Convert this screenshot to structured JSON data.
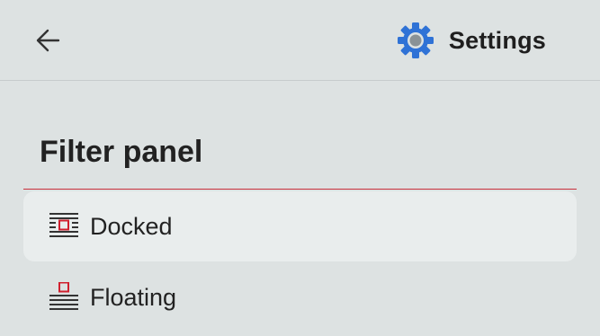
{
  "header": {
    "back_icon": "arrow-left-icon",
    "settings_icon": "gear-icon",
    "title": "Settings",
    "accent_color": "#2f72d6"
  },
  "section": {
    "title": "Filter panel",
    "divider_color": "#c8303c"
  },
  "options": [
    {
      "label": "Docked",
      "icon": "docked-panel-icon",
      "selected": true
    },
    {
      "label": "Floating",
      "icon": "floating-panel-icon",
      "selected": false
    }
  ]
}
